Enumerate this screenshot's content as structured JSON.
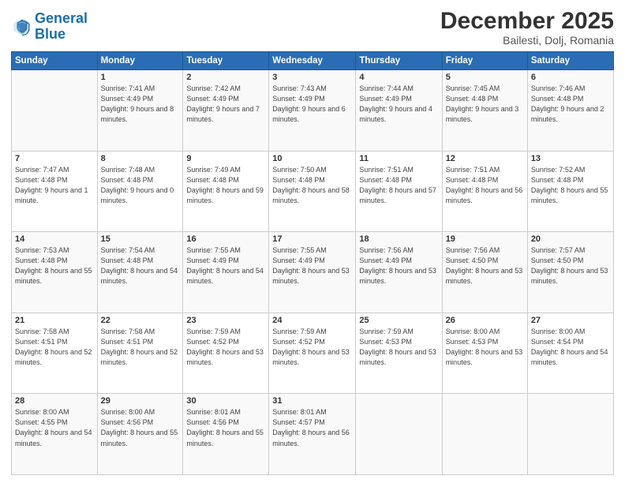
{
  "header": {
    "logo_line1": "General",
    "logo_line2": "Blue",
    "month_year": "December 2025",
    "location": "Bailesti, Dolj, Romania"
  },
  "weekdays": [
    "Sunday",
    "Monday",
    "Tuesday",
    "Wednesday",
    "Thursday",
    "Friday",
    "Saturday"
  ],
  "weeks": [
    [
      {
        "day": "",
        "info": ""
      },
      {
        "day": "1",
        "info": "Sunrise: 7:41 AM\nSunset: 4:49 PM\nDaylight: 9 hours\nand 8 minutes."
      },
      {
        "day": "2",
        "info": "Sunrise: 7:42 AM\nSunset: 4:49 PM\nDaylight: 9 hours\nand 7 minutes."
      },
      {
        "day": "3",
        "info": "Sunrise: 7:43 AM\nSunset: 4:49 PM\nDaylight: 9 hours\nand 6 minutes."
      },
      {
        "day": "4",
        "info": "Sunrise: 7:44 AM\nSunset: 4:49 PM\nDaylight: 9 hours\nand 4 minutes."
      },
      {
        "day": "5",
        "info": "Sunrise: 7:45 AM\nSunset: 4:48 PM\nDaylight: 9 hours\nand 3 minutes."
      },
      {
        "day": "6",
        "info": "Sunrise: 7:46 AM\nSunset: 4:48 PM\nDaylight: 9 hours\nand 2 minutes."
      }
    ],
    [
      {
        "day": "7",
        "info": "Sunrise: 7:47 AM\nSunset: 4:48 PM\nDaylight: 9 hours\nand 1 minute."
      },
      {
        "day": "8",
        "info": "Sunrise: 7:48 AM\nSunset: 4:48 PM\nDaylight: 9 hours\nand 0 minutes."
      },
      {
        "day": "9",
        "info": "Sunrise: 7:49 AM\nSunset: 4:48 PM\nDaylight: 8 hours\nand 59 minutes."
      },
      {
        "day": "10",
        "info": "Sunrise: 7:50 AM\nSunset: 4:48 PM\nDaylight: 8 hours\nand 58 minutes."
      },
      {
        "day": "11",
        "info": "Sunrise: 7:51 AM\nSunset: 4:48 PM\nDaylight: 8 hours\nand 57 minutes."
      },
      {
        "day": "12",
        "info": "Sunrise: 7:51 AM\nSunset: 4:48 PM\nDaylight: 8 hours\nand 56 minutes."
      },
      {
        "day": "13",
        "info": "Sunrise: 7:52 AM\nSunset: 4:48 PM\nDaylight: 8 hours\nand 55 minutes."
      }
    ],
    [
      {
        "day": "14",
        "info": "Sunrise: 7:53 AM\nSunset: 4:48 PM\nDaylight: 8 hours\nand 55 minutes."
      },
      {
        "day": "15",
        "info": "Sunrise: 7:54 AM\nSunset: 4:48 PM\nDaylight: 8 hours\nand 54 minutes."
      },
      {
        "day": "16",
        "info": "Sunrise: 7:55 AM\nSunset: 4:49 PM\nDaylight: 8 hours\nand 54 minutes."
      },
      {
        "day": "17",
        "info": "Sunrise: 7:55 AM\nSunset: 4:49 PM\nDaylight: 8 hours\nand 53 minutes."
      },
      {
        "day": "18",
        "info": "Sunrise: 7:56 AM\nSunset: 4:49 PM\nDaylight: 8 hours\nand 53 minutes."
      },
      {
        "day": "19",
        "info": "Sunrise: 7:56 AM\nSunset: 4:50 PM\nDaylight: 8 hours\nand 53 minutes."
      },
      {
        "day": "20",
        "info": "Sunrise: 7:57 AM\nSunset: 4:50 PM\nDaylight: 8 hours\nand 53 minutes."
      }
    ],
    [
      {
        "day": "21",
        "info": "Sunrise: 7:58 AM\nSunset: 4:51 PM\nDaylight: 8 hours\nand 52 minutes."
      },
      {
        "day": "22",
        "info": "Sunrise: 7:58 AM\nSunset: 4:51 PM\nDaylight: 8 hours\nand 52 minutes."
      },
      {
        "day": "23",
        "info": "Sunrise: 7:59 AM\nSunset: 4:52 PM\nDaylight: 8 hours\nand 53 minutes."
      },
      {
        "day": "24",
        "info": "Sunrise: 7:59 AM\nSunset: 4:52 PM\nDaylight: 8 hours\nand 53 minutes."
      },
      {
        "day": "25",
        "info": "Sunrise: 7:59 AM\nSunset: 4:53 PM\nDaylight: 8 hours\nand 53 minutes."
      },
      {
        "day": "26",
        "info": "Sunrise: 8:00 AM\nSunset: 4:53 PM\nDaylight: 8 hours\nand 53 minutes."
      },
      {
        "day": "27",
        "info": "Sunrise: 8:00 AM\nSunset: 4:54 PM\nDaylight: 8 hours\nand 54 minutes."
      }
    ],
    [
      {
        "day": "28",
        "info": "Sunrise: 8:00 AM\nSunset: 4:55 PM\nDaylight: 8 hours\nand 54 minutes."
      },
      {
        "day": "29",
        "info": "Sunrise: 8:00 AM\nSunset: 4:56 PM\nDaylight: 8 hours\nand 55 minutes."
      },
      {
        "day": "30",
        "info": "Sunrise: 8:01 AM\nSunset: 4:56 PM\nDaylight: 8 hours\nand 55 minutes."
      },
      {
        "day": "31",
        "info": "Sunrise: 8:01 AM\nSunset: 4:57 PM\nDaylight: 8 hours\nand 56 minutes."
      },
      {
        "day": "",
        "info": ""
      },
      {
        "day": "",
        "info": ""
      },
      {
        "day": "",
        "info": ""
      }
    ]
  ]
}
